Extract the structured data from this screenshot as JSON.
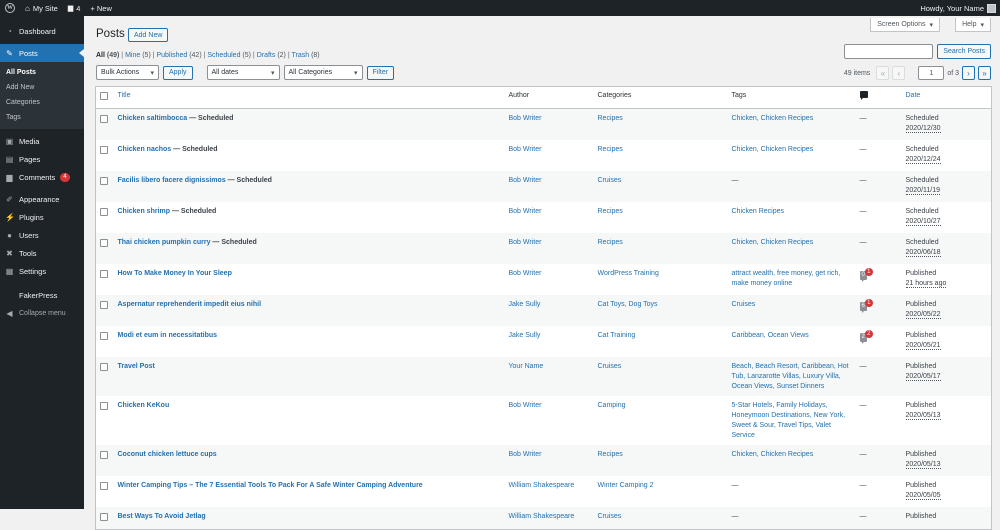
{
  "adminbar": {
    "site": "My Site",
    "comments": "4",
    "new": "+ New",
    "howdy": "Howdy, Your Name"
  },
  "menu": {
    "dashboard": "Dashboard",
    "posts": "Posts",
    "sub": [
      "All Posts",
      "Add New",
      "Categories",
      "Tags"
    ],
    "media": "Media",
    "pages": "Pages",
    "comments": "Comments",
    "comments_badge": "4",
    "appearance": "Appearance",
    "plugins": "Plugins",
    "users": "Users",
    "tools": "Tools",
    "settings": "Settings",
    "fakerpress": "FakerPress",
    "collapse": "Collapse menu"
  },
  "screen_options": "Screen Options",
  "help": "Help",
  "page_title": "Posts",
  "add_new": "Add New",
  "views": [
    {
      "label": "All",
      "count": "(49)"
    },
    {
      "label": "Mine",
      "count": "(5)"
    },
    {
      "label": "Published",
      "count": "(42)"
    },
    {
      "label": "Scheduled",
      "count": "(5)"
    },
    {
      "label": "Drafts",
      "count": "(2)"
    },
    {
      "label": "Trash",
      "count": "(8)"
    }
  ],
  "search_button": "Search Posts",
  "search_value": "",
  "filters": {
    "bulk": "Bulk Actions",
    "apply": "Apply",
    "dates": "All dates",
    "cats": "All Categories",
    "filter": "Filter"
  },
  "pagination": {
    "items": "49 items",
    "first": "«",
    "prev": "‹",
    "page": "1",
    "of": "of 3",
    "next": "›",
    "last": "»"
  },
  "columns": {
    "title": "Title",
    "author": "Author",
    "categories": "Categories",
    "tags": "Tags",
    "date": "Date"
  },
  "rows": [
    {
      "title": "Chicken saltimbocca",
      "state": " — Scheduled",
      "author": "Bob Writer",
      "cats": "Recipes",
      "tags": "Chicken, Chicken Recipes",
      "comments": "—",
      "status": "Scheduled",
      "date": "2020/12/30"
    },
    {
      "title": "Chicken nachos",
      "state": " — Scheduled",
      "author": "Bob Writer",
      "cats": "Recipes",
      "tags": "Chicken, Chicken Recipes",
      "comments": "—",
      "status": "Scheduled",
      "date": "2020/12/24"
    },
    {
      "title": "Facilis libero facere dignissimos",
      "state": " — Scheduled",
      "author": "Bob Writer",
      "cats": "Cruises",
      "tags": "—",
      "comments": "—",
      "status": "Scheduled",
      "date": "2020/11/19"
    },
    {
      "title": "Chicken shrimp",
      "state": " — Scheduled",
      "author": "Bob Writer",
      "cats": "Recipes",
      "tags": "Chicken Recipes",
      "comments": "—",
      "status": "Scheduled",
      "date": "2020/10/27"
    },
    {
      "title": "Thai chicken pumpkin curry",
      "state": " — Scheduled",
      "author": "Bob Writer",
      "cats": "Recipes",
      "tags": "Chicken, Chicken Recipes",
      "comments": "—",
      "status": "Scheduled",
      "date": "2020/06/18"
    },
    {
      "title": "How To Make Money In Your Sleep",
      "state": "",
      "author": "Bob Writer",
      "cats": "WordPress Training",
      "tags": "attract wealth, free money, get rich, make money online",
      "comments": "0",
      "pending": "1",
      "status": "Published",
      "date": "21 hours ago"
    },
    {
      "title": "Aspernatur reprehenderit impedit eius nihil",
      "state": "",
      "author": "Jake Sully",
      "cats": "Cat Toys, Dog Toys",
      "tags": "Cruises",
      "comments": "6",
      "pending": "1",
      "status": "Published",
      "date": "2020/05/22"
    },
    {
      "title": "Modi et eum in necessitatibus",
      "state": "",
      "author": "Jake Sully",
      "cats": "Cat Training",
      "tags": "Caribbean, Ocean Views",
      "comments": "2",
      "pending": "2",
      "status": "Published",
      "date": "2020/05/21"
    },
    {
      "title": "Travel Post",
      "state": "",
      "author": "Your Name",
      "cats": "Cruises",
      "tags": "Beach, Beach Resort, Caribbean, Hot Tub, Lanzarotte Villas, Luxury Villa, Ocean Views, Sunset Dinners",
      "comments": "—",
      "status": "Published",
      "date": "2020/05/17"
    },
    {
      "title": "Chicken KeKou",
      "state": "",
      "author": "Bob Writer",
      "cats": "Camping",
      "tags": "5-Star Hotels, Family Holidays, Honeymoon Destinations, New York, Sweet & Sour, Travel Tips, Valet Service",
      "comments": "—",
      "status": "Published",
      "date": "2020/05/13"
    },
    {
      "title": "Coconut chicken lettuce cups",
      "state": "",
      "author": "Bob Writer",
      "cats": "Recipes",
      "tags": "Chicken, Chicken Recipes",
      "comments": "—",
      "status": "Published",
      "date": "2020/05/13"
    },
    {
      "title": "Winter Camping Tips –  The 7 Essential  Tools To Pack For A Safe Winter Camping Adventure",
      "state": "",
      "author": "William Shakespeare",
      "cats": "Winter Camping 2",
      "tags": "—",
      "comments": "—",
      "status": "Published",
      "date": "2020/05/05"
    },
    {
      "title": "Best Ways To Avoid Jetlag",
      "state": "",
      "author": "William Shakespeare",
      "cats": "Cruises",
      "tags": "—",
      "comments": "—",
      "status": "Published",
      "date": ""
    }
  ]
}
